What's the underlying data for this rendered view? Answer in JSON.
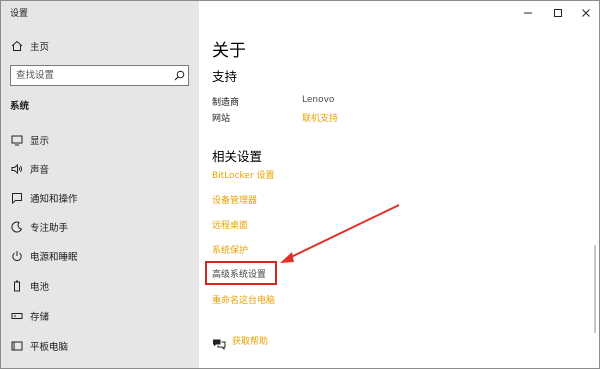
{
  "window": {
    "title": "设置"
  },
  "sidebar": {
    "home_label": "主页",
    "search_placeholder": "查找设置",
    "section_label": "系统",
    "items": [
      {
        "label": "显示",
        "icon": "monitor-icon"
      },
      {
        "label": "声音",
        "icon": "speaker-icon"
      },
      {
        "label": "通知和操作",
        "icon": "notification-icon"
      },
      {
        "label": "专注助手",
        "icon": "moon-icon"
      },
      {
        "label": "电源和睡眠",
        "icon": "power-icon"
      },
      {
        "label": "电池",
        "icon": "battery-icon"
      },
      {
        "label": "存储",
        "icon": "storage-icon"
      },
      {
        "label": "平板电脑",
        "icon": "tablet-icon"
      }
    ]
  },
  "main": {
    "title": "关于",
    "support": {
      "heading": "支持",
      "manufacturer_key": "制造商",
      "manufacturer_value": "Lenovo",
      "website_key": "网站",
      "website_value": "联机支持"
    },
    "related": {
      "heading": "相关设置",
      "links": [
        "BitLocker 设置",
        "设备管理器",
        "远程桌面",
        "系统保护",
        "高级系统设置",
        "重命名这台电脑"
      ]
    },
    "help_label": "获取帮助"
  },
  "colors": {
    "link": "#e8a200",
    "highlight": "#d9251f",
    "sidebar_bg": "#e6e6e6"
  }
}
